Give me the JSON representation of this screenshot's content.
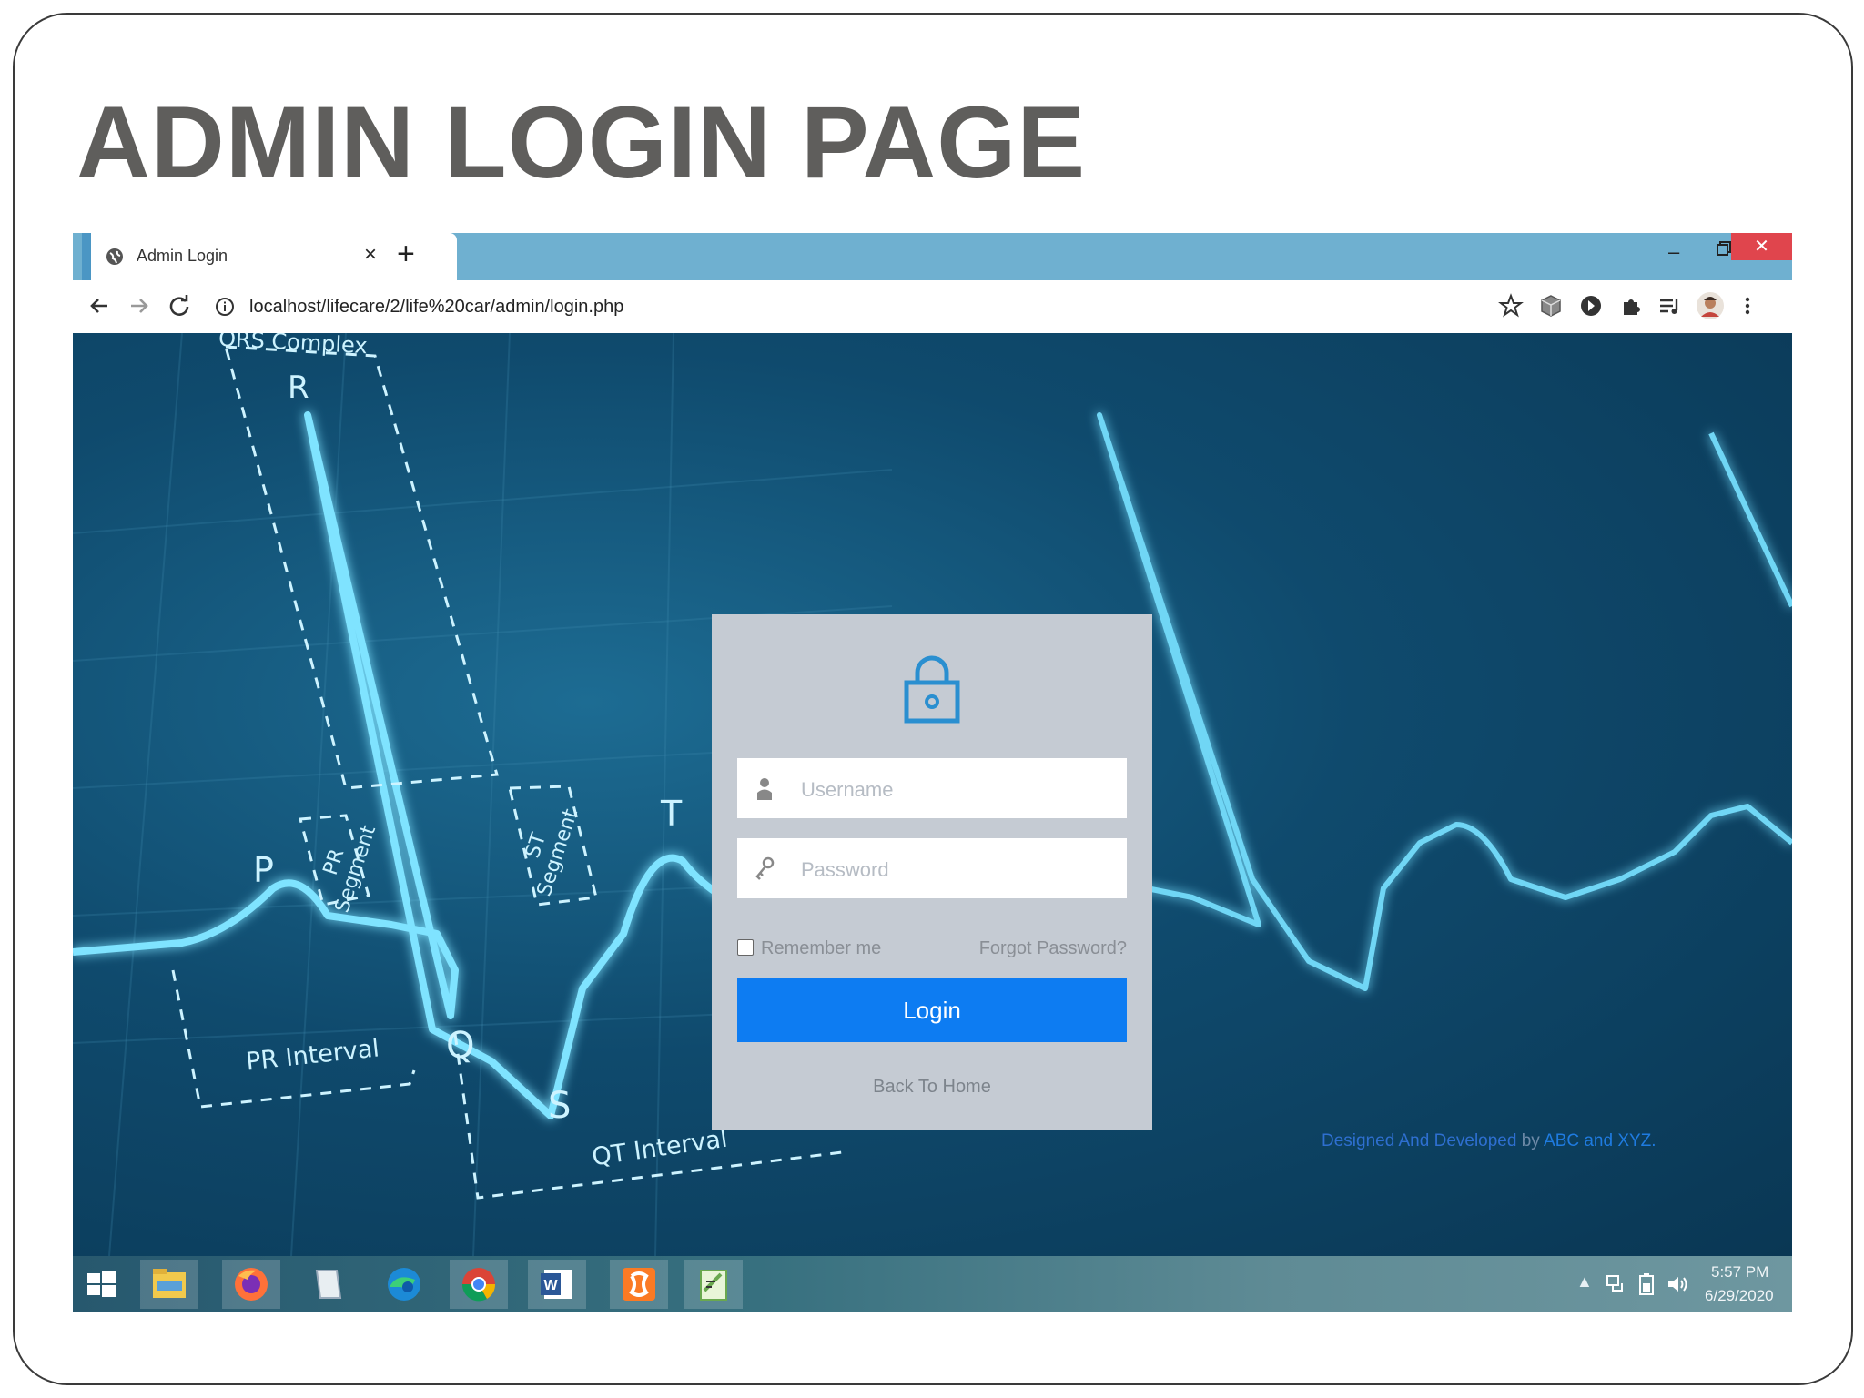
{
  "slide": {
    "title": "ADMIN LOGIN PAGE"
  },
  "browser": {
    "tab_title": "Admin Login",
    "tab_close": "×",
    "new_tab": "+",
    "win_min": "–",
    "win_close": "✕",
    "url": "localhost/lifecare/2/life%20car/admin/login.php"
  },
  "background": {
    "labels": {
      "qrs": "QRS Complex",
      "r": "R",
      "p": "P",
      "q": "Q",
      "s": "S",
      "t": "T",
      "pr_segment": "PR Segment",
      "st_segment": "ST Segment",
      "pr_interval": "PR Interval",
      "qt_interval": "QT Interval"
    }
  },
  "login": {
    "username_placeholder": "Username",
    "password_placeholder": "Password",
    "remember_label": "Remember me",
    "forgot_label": "Forgot Password?",
    "login_button": "Login",
    "back_home": "Back To Home"
  },
  "footer": {
    "designed": "Designed And Developed",
    "by": " by ",
    "names": "ABC and XYZ."
  },
  "taskbar": {
    "time": "5:57 PM",
    "date": "6/29/2020",
    "items": [
      "start",
      "file-explorer",
      "firefox",
      "notes",
      "edge",
      "chrome",
      "word",
      "xampp",
      "notepad-plus"
    ]
  },
  "colors": {
    "accent": "#0d7cf2",
    "tabbar": "#6fb0d0",
    "card": "#c5cbd3",
    "ecg": "#7fe3ff"
  }
}
